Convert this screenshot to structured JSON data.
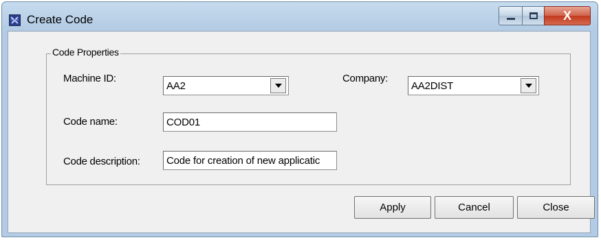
{
  "window": {
    "title": "Create Code",
    "minimize_icon": "minimize-icon",
    "maximize_icon": "maximize-icon",
    "close_glyph": "X"
  },
  "group": {
    "title": "Code Properties"
  },
  "form": {
    "machine_id": {
      "label": "Machine ID:",
      "value": "AA2"
    },
    "company": {
      "label": "Company:",
      "value": "AA2DIST"
    },
    "code_name": {
      "label": "Code name:",
      "value": "COD01"
    },
    "code_description": {
      "label": "Code description:",
      "value": "Code for creation of new applicatic"
    }
  },
  "buttons": {
    "apply": "Apply",
    "cancel": "Cancel",
    "close": "Close"
  }
}
